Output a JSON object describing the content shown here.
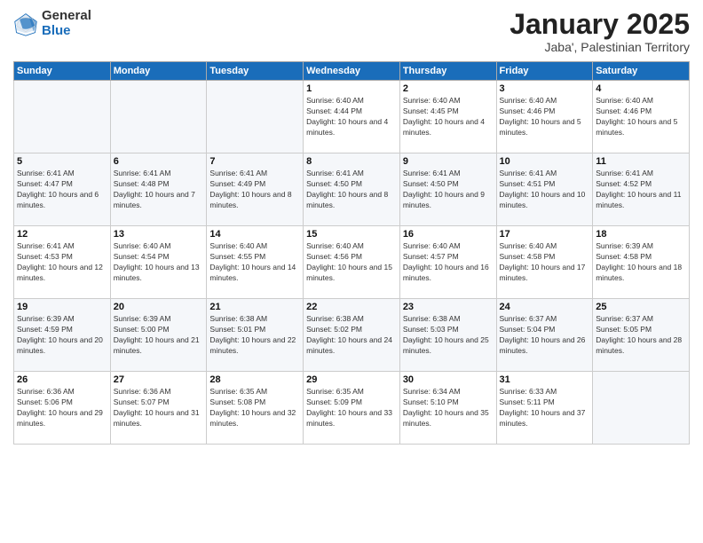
{
  "logo": {
    "general": "General",
    "blue": "Blue"
  },
  "title": "January 2025",
  "subtitle": "Jaba', Palestinian Territory",
  "weekdays": [
    "Sunday",
    "Monday",
    "Tuesday",
    "Wednesday",
    "Thursday",
    "Friday",
    "Saturday"
  ],
  "weeks": [
    [
      null,
      null,
      null,
      {
        "day": 1,
        "sunrise": "6:40 AM",
        "sunset": "4:44 PM",
        "daylight": "10 hours and 4 minutes."
      },
      {
        "day": 2,
        "sunrise": "6:40 AM",
        "sunset": "4:45 PM",
        "daylight": "10 hours and 4 minutes."
      },
      {
        "day": 3,
        "sunrise": "6:40 AM",
        "sunset": "4:46 PM",
        "daylight": "10 hours and 5 minutes."
      },
      {
        "day": 4,
        "sunrise": "6:40 AM",
        "sunset": "4:46 PM",
        "daylight": "10 hours and 5 minutes."
      }
    ],
    [
      {
        "day": 5,
        "sunrise": "6:41 AM",
        "sunset": "4:47 PM",
        "daylight": "10 hours and 6 minutes."
      },
      {
        "day": 6,
        "sunrise": "6:41 AM",
        "sunset": "4:48 PM",
        "daylight": "10 hours and 7 minutes."
      },
      {
        "day": 7,
        "sunrise": "6:41 AM",
        "sunset": "4:49 PM",
        "daylight": "10 hours and 8 minutes."
      },
      {
        "day": 8,
        "sunrise": "6:41 AM",
        "sunset": "4:50 PM",
        "daylight": "10 hours and 8 minutes."
      },
      {
        "day": 9,
        "sunrise": "6:41 AM",
        "sunset": "4:50 PM",
        "daylight": "10 hours and 9 minutes."
      },
      {
        "day": 10,
        "sunrise": "6:41 AM",
        "sunset": "4:51 PM",
        "daylight": "10 hours and 10 minutes."
      },
      {
        "day": 11,
        "sunrise": "6:41 AM",
        "sunset": "4:52 PM",
        "daylight": "10 hours and 11 minutes."
      }
    ],
    [
      {
        "day": 12,
        "sunrise": "6:41 AM",
        "sunset": "4:53 PM",
        "daylight": "10 hours and 12 minutes."
      },
      {
        "day": 13,
        "sunrise": "6:40 AM",
        "sunset": "4:54 PM",
        "daylight": "10 hours and 13 minutes."
      },
      {
        "day": 14,
        "sunrise": "6:40 AM",
        "sunset": "4:55 PM",
        "daylight": "10 hours and 14 minutes."
      },
      {
        "day": 15,
        "sunrise": "6:40 AM",
        "sunset": "4:56 PM",
        "daylight": "10 hours and 15 minutes."
      },
      {
        "day": 16,
        "sunrise": "6:40 AM",
        "sunset": "4:57 PM",
        "daylight": "10 hours and 16 minutes."
      },
      {
        "day": 17,
        "sunrise": "6:40 AM",
        "sunset": "4:58 PM",
        "daylight": "10 hours and 17 minutes."
      },
      {
        "day": 18,
        "sunrise": "6:39 AM",
        "sunset": "4:58 PM",
        "daylight": "10 hours and 18 minutes."
      }
    ],
    [
      {
        "day": 19,
        "sunrise": "6:39 AM",
        "sunset": "4:59 PM",
        "daylight": "10 hours and 20 minutes."
      },
      {
        "day": 20,
        "sunrise": "6:39 AM",
        "sunset": "5:00 PM",
        "daylight": "10 hours and 21 minutes."
      },
      {
        "day": 21,
        "sunrise": "6:38 AM",
        "sunset": "5:01 PM",
        "daylight": "10 hours and 22 minutes."
      },
      {
        "day": 22,
        "sunrise": "6:38 AM",
        "sunset": "5:02 PM",
        "daylight": "10 hours and 24 minutes."
      },
      {
        "day": 23,
        "sunrise": "6:38 AM",
        "sunset": "5:03 PM",
        "daylight": "10 hours and 25 minutes."
      },
      {
        "day": 24,
        "sunrise": "6:37 AM",
        "sunset": "5:04 PM",
        "daylight": "10 hours and 26 minutes."
      },
      {
        "day": 25,
        "sunrise": "6:37 AM",
        "sunset": "5:05 PM",
        "daylight": "10 hours and 28 minutes."
      }
    ],
    [
      {
        "day": 26,
        "sunrise": "6:36 AM",
        "sunset": "5:06 PM",
        "daylight": "10 hours and 29 minutes."
      },
      {
        "day": 27,
        "sunrise": "6:36 AM",
        "sunset": "5:07 PM",
        "daylight": "10 hours and 31 minutes."
      },
      {
        "day": 28,
        "sunrise": "6:35 AM",
        "sunset": "5:08 PM",
        "daylight": "10 hours and 32 minutes."
      },
      {
        "day": 29,
        "sunrise": "6:35 AM",
        "sunset": "5:09 PM",
        "daylight": "10 hours and 33 minutes."
      },
      {
        "day": 30,
        "sunrise": "6:34 AM",
        "sunset": "5:10 PM",
        "daylight": "10 hours and 35 minutes."
      },
      {
        "day": 31,
        "sunrise": "6:33 AM",
        "sunset": "5:11 PM",
        "daylight": "10 hours and 37 minutes."
      },
      null
    ]
  ]
}
